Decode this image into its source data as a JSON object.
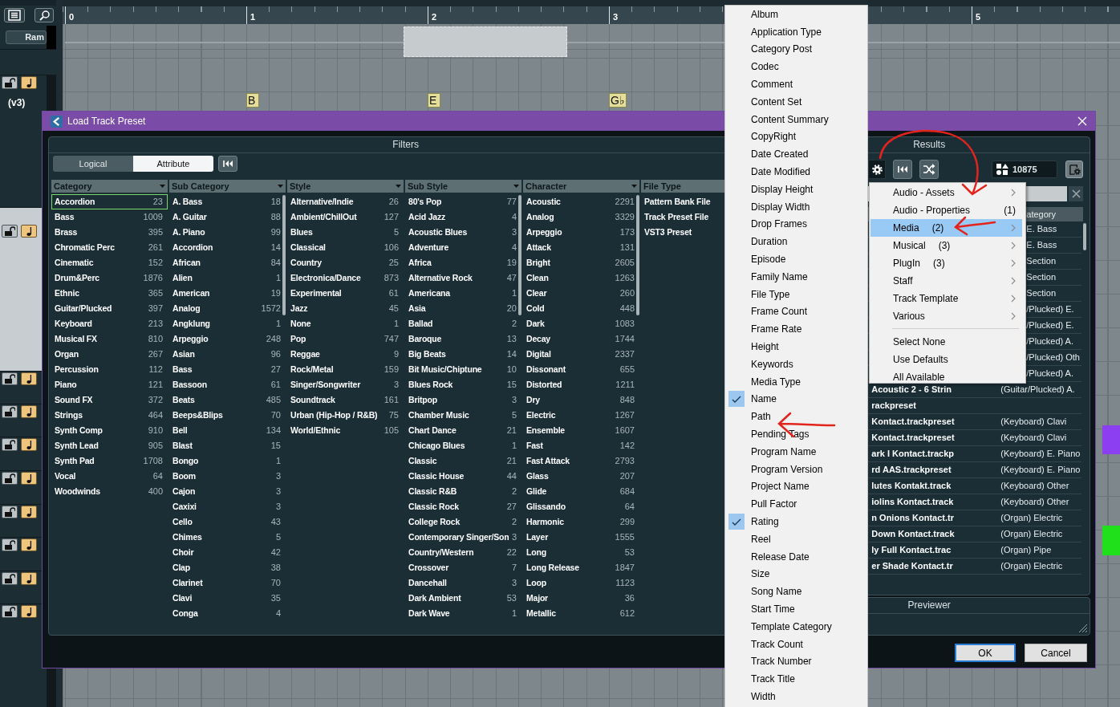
{
  "arrangement": {
    "ruler": [
      "0",
      "1",
      "2",
      "3",
      "5"
    ],
    "chords": [
      "B",
      "E",
      "G♭"
    ],
    "track_name": "(v3)",
    "lane_button": "Ram"
  },
  "dialog": {
    "title": "Load Track Preset",
    "filters": {
      "title": "Filters",
      "modes": [
        {
          "label": "Logical",
          "selected": false
        },
        {
          "label": "Attribute",
          "selected": true
        }
      ],
      "columns": [
        {
          "title": "Category",
          "dropdown": true,
          "items": [
            {
              "label": "Accordion",
              "count": "23",
              "selected": true
            },
            {
              "label": "Bass",
              "count": "1009",
              "selected": false
            },
            {
              "label": "Brass",
              "count": "395",
              "selected": false
            },
            {
              "label": "Chromatic Perc",
              "count": "261",
              "selected": false
            },
            {
              "label": "Cinematic",
              "count": "152",
              "selected": false
            },
            {
              "label": "Drum&Perc",
              "count": "1876",
              "selected": false
            },
            {
              "label": "Ethnic",
              "count": "365",
              "selected": false
            },
            {
              "label": "Guitar/Plucked",
              "count": "397",
              "selected": false
            },
            {
              "label": "Keyboard",
              "count": "213",
              "selected": false
            },
            {
              "label": "Musical FX",
              "count": "810",
              "selected": false
            },
            {
              "label": "Organ",
              "count": "267",
              "selected": false
            },
            {
              "label": "Percussion",
              "count": "112",
              "selected": false
            },
            {
              "label": "Piano",
              "count": "121",
              "selected": false
            },
            {
              "label": "Sound FX",
              "count": "372",
              "selected": false
            },
            {
              "label": "Strings",
              "count": "464",
              "selected": false
            },
            {
              "label": "Synth Comp",
              "count": "910",
              "selected": false
            },
            {
              "label": "Synth Lead",
              "count": "905",
              "selected": false
            },
            {
              "label": "Synth Pad",
              "count": "1708",
              "selected": false
            },
            {
              "label": "Vocal",
              "count": "64",
              "selected": false
            },
            {
              "label": "Woodwinds",
              "count": "400",
              "selected": false
            }
          ]
        },
        {
          "title": "Sub Category",
          "dropdown": true,
          "scrollable": true,
          "items": [
            {
              "label": "A. Bass",
              "count": "18"
            },
            {
              "label": "A. Guitar",
              "count": "88"
            },
            {
              "label": "A. Piano",
              "count": "99"
            },
            {
              "label": "Accordion",
              "count": "14"
            },
            {
              "label": "African",
              "count": "84"
            },
            {
              "label": "Alien",
              "count": "1"
            },
            {
              "label": "American",
              "count": "19"
            },
            {
              "label": "Analog",
              "count": "1572"
            },
            {
              "label": "Angklung",
              "count": "1"
            },
            {
              "label": "Arpeggio",
              "count": "248"
            },
            {
              "label": "Asian",
              "count": "96"
            },
            {
              "label": "Bass",
              "count": "27"
            },
            {
              "label": "Bassoon",
              "count": "61"
            },
            {
              "label": "Beats",
              "count": "485"
            },
            {
              "label": "Beeps&Blips",
              "count": "70"
            },
            {
              "label": "Bell",
              "count": "134"
            },
            {
              "label": "Blast",
              "count": "15"
            },
            {
              "label": "Bongo",
              "count": "1"
            },
            {
              "label": "Boom",
              "count": "3"
            },
            {
              "label": "Cajon",
              "count": "3"
            },
            {
              "label": "Caxixi",
              "count": "3"
            },
            {
              "label": "Cello",
              "count": "43"
            },
            {
              "label": "Chimes",
              "count": "5"
            },
            {
              "label": "Choir",
              "count": "42"
            },
            {
              "label": "Clap",
              "count": "38"
            },
            {
              "label": "Clarinet",
              "count": "70"
            },
            {
              "label": "Clavi",
              "count": "35"
            },
            {
              "label": "Conga",
              "count": "4"
            }
          ]
        },
        {
          "title": "Style",
          "dropdown": true,
          "items": [
            {
              "label": "Alternative/Indie",
              "count": "26"
            },
            {
              "label": "Ambient/ChillOut",
              "count": "127"
            },
            {
              "label": "Blues",
              "count": "5"
            },
            {
              "label": "Classical",
              "count": "106"
            },
            {
              "label": "Country",
              "count": "25"
            },
            {
              "label": "Electronica/Dance",
              "count": "873"
            },
            {
              "label": "Experimental",
              "count": "61"
            },
            {
              "label": "Jazz",
              "count": "45"
            },
            {
              "label": "None",
              "count": "1"
            },
            {
              "label": "Pop",
              "count": "747"
            },
            {
              "label": "Reggae",
              "count": "9"
            },
            {
              "label": "Rock/Metal",
              "count": "159"
            },
            {
              "label": "Singer/Songwriter",
              "count": "3"
            },
            {
              "label": "Soundtrack",
              "count": "161"
            },
            {
              "label": "Urban (Hip-Hop / R&B)",
              "count": "75"
            },
            {
              "label": "World/Ethnic",
              "count": "105"
            }
          ]
        },
        {
          "title": "Sub Style",
          "dropdown": true,
          "scrollable": true,
          "items": [
            {
              "label": "80's Pop",
              "count": "77"
            },
            {
              "label": "Acid Jazz",
              "count": "4"
            },
            {
              "label": "Acoustic Blues",
              "count": "3"
            },
            {
              "label": "Adventure",
              "count": "4"
            },
            {
              "label": "Africa",
              "count": "19"
            },
            {
              "label": "Alternative Rock",
              "count": "47"
            },
            {
              "label": "Americana",
              "count": "1"
            },
            {
              "label": "Asia",
              "count": "20"
            },
            {
              "label": "Ballad",
              "count": "2"
            },
            {
              "label": "Baroque",
              "count": "13"
            },
            {
              "label": "Big Beats",
              "count": "14"
            },
            {
              "label": "Bit Music/Chiptune",
              "count": "10"
            },
            {
              "label": "Blues Rock",
              "count": "15"
            },
            {
              "label": "Britpop",
              "count": "3"
            },
            {
              "label": "Chamber Music",
              "count": "5"
            },
            {
              "label": "Chart Dance",
              "count": "21"
            },
            {
              "label": "Chicago Blues",
              "count": "1"
            },
            {
              "label": "Classic",
              "count": "21"
            },
            {
              "label": "Classic House",
              "count": "44"
            },
            {
              "label": "Classic R&B",
              "count": "2"
            },
            {
              "label": "Classic Rock",
              "count": "27"
            },
            {
              "label": "College Rock",
              "count": "2"
            },
            {
              "label": "Contemporary Singer/Son",
              "count": "3"
            },
            {
              "label": "Country/Western",
              "count": "22"
            },
            {
              "label": "Crossover",
              "count": "7"
            },
            {
              "label": "Dancehall",
              "count": "3"
            },
            {
              "label": "Dark Ambient",
              "count": "53"
            },
            {
              "label": "Dark Wave",
              "count": "1"
            }
          ]
        },
        {
          "title": "Character",
          "dropdown": true,
          "scrollable": true,
          "items": [
            {
              "label": "Acoustic",
              "count": "2291"
            },
            {
              "label": "Analog",
              "count": "3329"
            },
            {
              "label": "Arpeggio",
              "count": "173"
            },
            {
              "label": "Attack",
              "count": "131"
            },
            {
              "label": "Bright",
              "count": "2605"
            },
            {
              "label": "Clean",
              "count": "1263"
            },
            {
              "label": "Clear",
              "count": "260"
            },
            {
              "label": "Cold",
              "count": "448"
            },
            {
              "label": "Dark",
              "count": "1083"
            },
            {
              "label": "Decay",
              "count": "1744"
            },
            {
              "label": "Digital",
              "count": "2337"
            },
            {
              "label": "Dissonant",
              "count": "655"
            },
            {
              "label": "Distorted",
              "count": "1211"
            },
            {
              "label": "Dry",
              "count": "848"
            },
            {
              "label": "Electric",
              "count": "1267"
            },
            {
              "label": "Ensemble",
              "count": "1607"
            },
            {
              "label": "Fast",
              "count": "142"
            },
            {
              "label": "Fast Attack",
              "count": "2793"
            },
            {
              "label": "Glass",
              "count": "207"
            },
            {
              "label": "Glide",
              "count": "684"
            },
            {
              "label": "Glissando",
              "count": "64"
            },
            {
              "label": "Harmonic",
              "count": "299"
            },
            {
              "label": "Layer",
              "count": "1555"
            },
            {
              "label": "Long",
              "count": "53"
            },
            {
              "label": "Long Release",
              "count": "1847"
            },
            {
              "label": "Loop",
              "count": "1123"
            },
            {
              "label": "Major",
              "count": "36"
            },
            {
              "label": "Metallic",
              "count": "612"
            }
          ]
        },
        {
          "title": "File Type",
          "items": [
            {
              "label": "Pattern Bank File"
            },
            {
              "label": "Track Preset File"
            },
            {
              "label": "VST3 Preset"
            }
          ]
        }
      ]
    },
    "results": {
      "title": "Results",
      "count": "10875",
      "header": "ategory",
      "rows": [
        {
          "kind": "partial",
          "category": "E. Bass"
        },
        {
          "kind": "partial",
          "category": "E. Bass"
        },
        {
          "kind": "partial",
          "category": "Section"
        },
        {
          "kind": "partial",
          "category": "Section"
        },
        {
          "kind": "partial",
          "category": "Section"
        },
        {
          "kind": "partial",
          "category": "/Plucked) E."
        },
        {
          "kind": "partial",
          "category": "/Plucked) E."
        },
        {
          "kind": "partial",
          "category": "/Plucked) A."
        },
        {
          "kind": "partial",
          "category": "/Plucked) Oth"
        },
        {
          "kind": "partial",
          "category": "/Plucked) A."
        },
        {
          "kind": "full",
          "name": "Acoustic 2 - 6 Strin",
          "category": "(Guitar/Plucked) A."
        },
        {
          "kind": "full",
          "name": "rackpreset"
        },
        {
          "kind": "full",
          "name": "Kontact.trackpreset",
          "category": "(Keyboard) Clavi"
        },
        {
          "kind": "full",
          "name": "Kontact.trackpreset",
          "category": "(Keyboard) Clavi"
        },
        {
          "kind": "full",
          "name": "ark I Kontact.trackp",
          "category": "(Keyboard) E. Piano"
        },
        {
          "kind": "full",
          "name": "rd AAS.trackpreset",
          "category": "(Keyboard) E. Piano"
        },
        {
          "kind": "full",
          "name": "lutes Kontakt.track",
          "category": "(Keyboard) Other"
        },
        {
          "kind": "full",
          "name": "iolins Kontact.track",
          "category": "(Keyboard) Other"
        },
        {
          "kind": "full",
          "name": "n Onions Kontact.tr",
          "category": "(Organ) Electric"
        },
        {
          "kind": "full",
          "name": "Down Kontact.track",
          "category": "(Organ) Electric"
        },
        {
          "kind": "full",
          "name": "ly Full Kontact.trac",
          "category": "(Organ) Pipe"
        },
        {
          "kind": "full",
          "name": "er Shade Kontact.tr",
          "category": "(Organ) Electric"
        }
      ]
    },
    "previewer": {
      "title": "Previewer"
    },
    "buttons": [
      {
        "label": "OK",
        "default": true
      },
      {
        "label": "Cancel",
        "default": false
      }
    ]
  },
  "attribute_menu": {
    "items": [
      {
        "label": "Album",
        "checked": false
      },
      {
        "label": "Application Type",
        "checked": false
      },
      {
        "label": "Category Post",
        "checked": false
      },
      {
        "label": "Codec",
        "checked": false
      },
      {
        "label": "Comment",
        "checked": false
      },
      {
        "label": "Content Set",
        "checked": false
      },
      {
        "label": "Content Summary",
        "checked": false
      },
      {
        "label": "CopyRight",
        "checked": false
      },
      {
        "label": "Date Created",
        "checked": false
      },
      {
        "label": "Date Modified",
        "checked": false
      },
      {
        "label": "Display Height",
        "checked": false
      },
      {
        "label": "Display Width",
        "checked": false
      },
      {
        "label": "Drop Frames",
        "checked": false
      },
      {
        "label": "Duration",
        "checked": false
      },
      {
        "label": "Episode",
        "checked": false
      },
      {
        "label": "Family Name",
        "checked": false
      },
      {
        "label": "File Type",
        "checked": false
      },
      {
        "label": "Frame Count",
        "checked": false
      },
      {
        "label": "Frame Rate",
        "checked": false
      },
      {
        "label": "Height",
        "checked": false
      },
      {
        "label": "Keywords",
        "checked": false
      },
      {
        "label": "Media Type",
        "checked": false
      },
      {
        "label": "Name",
        "checked": true
      },
      {
        "label": "Path",
        "checked": false
      },
      {
        "label": "Pending Tags",
        "checked": false
      },
      {
        "label": "Program Name",
        "checked": false
      },
      {
        "label": "Program Version",
        "checked": false
      },
      {
        "label": "Project Name",
        "checked": false
      },
      {
        "label": "Pull Factor",
        "checked": false
      },
      {
        "label": "Rating",
        "checked": true
      },
      {
        "label": "Reel",
        "checked": false
      },
      {
        "label": "Release Date",
        "checked": false
      },
      {
        "label": "Size",
        "checked": false
      },
      {
        "label": "Song Name",
        "checked": false
      },
      {
        "label": "Start Time",
        "checked": false
      },
      {
        "label": "Template Category",
        "checked": false
      },
      {
        "label": "Track Count",
        "checked": false
      },
      {
        "label": "Track Number",
        "checked": false
      },
      {
        "label": "Track Title",
        "checked": false
      },
      {
        "label": "Width",
        "checked": false
      }
    ]
  },
  "settings_menu": {
    "items": [
      {
        "kind": "item",
        "label": "Audio - Assets",
        "submenu": true,
        "selected": false
      },
      {
        "kind": "item",
        "label": "Audio - Properties",
        "note": "(1)",
        "submenu": false,
        "selected": false
      },
      {
        "kind": "item",
        "label": "Media",
        "count": "(2)",
        "submenu": true,
        "selected": true
      },
      {
        "kind": "item",
        "label": "Musical",
        "count": "(3)",
        "submenu": true,
        "selected": false
      },
      {
        "kind": "item",
        "label": "PlugIn",
        "count": "(3)",
        "submenu": true,
        "selected": false
      },
      {
        "kind": "item",
        "label": "Staff",
        "submenu": true,
        "selected": false
      },
      {
        "kind": "item",
        "label": "Track Template",
        "submenu": true,
        "selected": false
      },
      {
        "kind": "item",
        "label": "Various",
        "submenu": true,
        "selected": false
      },
      {
        "kind": "separator"
      },
      {
        "kind": "item",
        "label": "Select None",
        "submenu": false,
        "selected": false
      },
      {
        "kind": "item",
        "label": "Use Defaults",
        "submenu": false,
        "selected": false
      },
      {
        "kind": "item",
        "label": "All Available",
        "submenu": false,
        "selected": false
      }
    ]
  }
}
